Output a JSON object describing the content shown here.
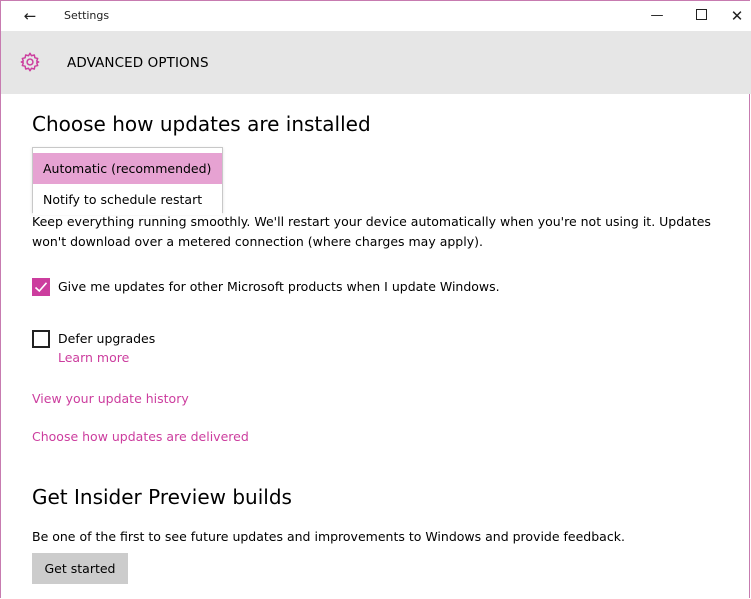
{
  "window": {
    "title": "Settings",
    "back_icon": "←",
    "minimize_glyph": "—",
    "close_glyph": "✕"
  },
  "header": {
    "title": "ADVANCED OPTIONS",
    "accent_color": "#cc3d9e"
  },
  "install_section": {
    "title": "Choose how updates are installed",
    "dropdown_options": [
      {
        "label": "Automatic (recommended)",
        "selected": true
      },
      {
        "label": "Notify to schedule restart",
        "selected": false
      }
    ],
    "description": "Keep everything running smoothly. We'll restart your device automatically when you're not using it. Updates won't download over a metered connection (where charges may apply)."
  },
  "checkboxes": [
    {
      "label": "Give me updates for other Microsoft products when I update Windows.",
      "checked": true
    },
    {
      "label": "Defer upgrades",
      "checked": false
    }
  ],
  "links": {
    "learn_more": "Learn more",
    "update_history": "View your update history",
    "delivery": "Choose how updates are delivered"
  },
  "insider": {
    "title": "Get Insider Preview builds",
    "description": "Be one of the first to see future updates and improvements to Windows and provide feedback.",
    "button_label": "Get started"
  }
}
